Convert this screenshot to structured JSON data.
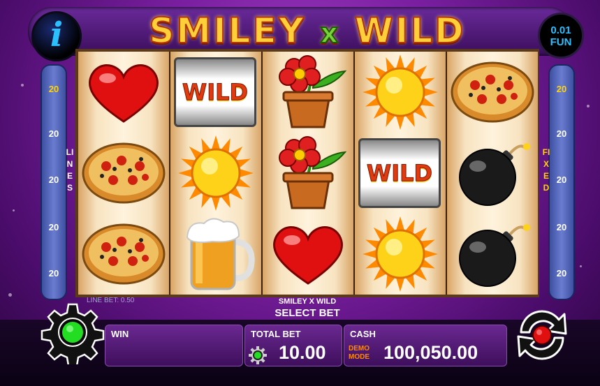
{
  "header": {
    "title_left": "SMILEY",
    "title_x": "x",
    "title_right": "WILD",
    "info_icon": "info-icon",
    "currency_value": "0.01",
    "currency_label": "FUN"
  },
  "left_panel": {
    "label": "LINES",
    "values": [
      "20",
      "20",
      "20",
      "20",
      "20"
    ]
  },
  "right_panel": {
    "label": "FIXED",
    "values": [
      "20",
      "20",
      "20",
      "20",
      "20"
    ]
  },
  "reels": [
    [
      "heart",
      "pizza",
      "pizza"
    ],
    [
      "wild",
      "sun",
      "beer"
    ],
    [
      "flower",
      "flower",
      "heart"
    ],
    [
      "sun",
      "wild",
      "sun"
    ],
    [
      "pizza",
      "bomb",
      "bomb"
    ]
  ],
  "wild_label": "WILD",
  "line_bet": "LINE BET: 0.50",
  "game_name": "SMILEY X WILD",
  "select_bet": "SELECT BET",
  "bottom": {
    "win_label": "WIN",
    "total_bet_label": "TOTAL BET",
    "total_bet_value": "10.00",
    "cash_label": "CASH",
    "demo_line1": "DEMO",
    "demo_line2": "MODE",
    "cash_value": "100,050.00"
  },
  "colors": {
    "accent_blue": "#2ac0ff",
    "active_yellow": "#ffd400",
    "settings_green": "#22dd22",
    "spin_red": "#e01010"
  }
}
